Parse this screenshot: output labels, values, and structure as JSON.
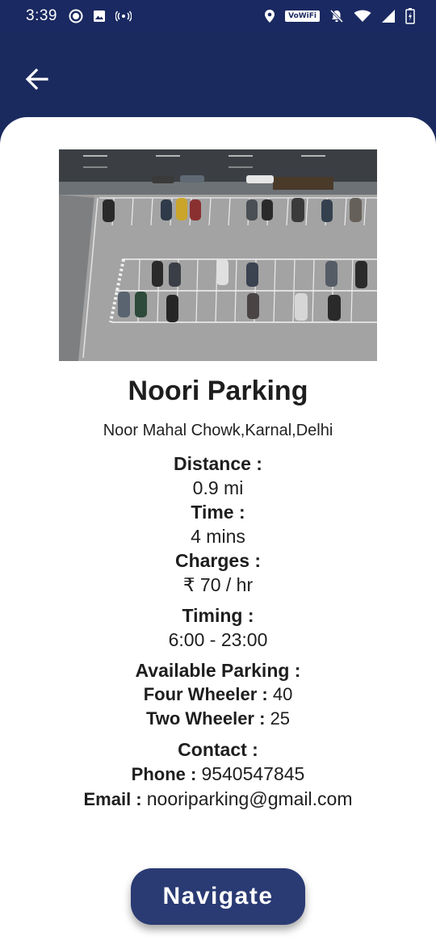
{
  "status_bar": {
    "time": "3:39",
    "wifi_label": "VoWiFi",
    "icons": [
      "record-icon",
      "image-icon",
      "hotspot-icon",
      "location-icon",
      "mute-icon",
      "wifi-icon",
      "signal-icon",
      "battery-icon"
    ]
  },
  "header": {
    "back_icon": "arrow-left-icon"
  },
  "parking": {
    "name": "Noori Parking",
    "address": "Noor Mahal Chowk,Karnal,Delhi",
    "distance_label": "Distance :",
    "distance_value": "0.9 mi",
    "time_label": "Time :",
    "time_value": "4 mins",
    "charges_label": "Charges :",
    "charges_value": "₹ 70 / hr",
    "timing_label": "Timing :",
    "timing_value": "6:00 - 23:00",
    "available_label": "Available Parking :",
    "four_wheeler_label": "Four Wheeler :",
    "four_wheeler_value": "40",
    "two_wheeler_label": "Two Wheeler :",
    "two_wheeler_value": "25",
    "contact_label": "Contact :",
    "phone_label": "Phone :",
    "phone_value": "9540547845",
    "email_label": "Email :",
    "email_value": "nooriparking@gmail.com"
  },
  "actions": {
    "navigate_label": "Navigate"
  },
  "colors": {
    "header_bg": "#1b2a5e",
    "button_bg": "#2a3a73",
    "card_bg": "#ffffff"
  }
}
